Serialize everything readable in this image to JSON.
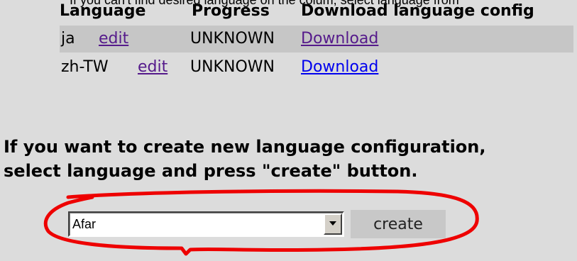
{
  "top_note": "If you can't find desired language on the colum, select language from",
  "table": {
    "headers": [
      "Language",
      "Progress",
      "Download language config"
    ],
    "rows": [
      {
        "language": "ja",
        "edit_label": "edit",
        "progress": "UNKNOWN",
        "download_label": "Download"
      },
      {
        "language": "zh-TW",
        "edit_label": "edit",
        "progress": "UNKNOWN",
        "download_label": "Download"
      }
    ]
  },
  "info": {
    "line1": "If you want to create new language configuration,",
    "line2": "select language and press \"create\" button."
  },
  "language_select": {
    "selected": "Afar"
  },
  "create_button": {
    "label": "create"
  },
  "colors": {
    "background": "#dcdcdc",
    "row_highlight": "#c6c6c6",
    "visited_link": "#551a8b",
    "unvisited_link": "#0000ee",
    "annotation": "#ee0000"
  },
  "icons": {
    "dropdown": "chevron-down-icon"
  }
}
